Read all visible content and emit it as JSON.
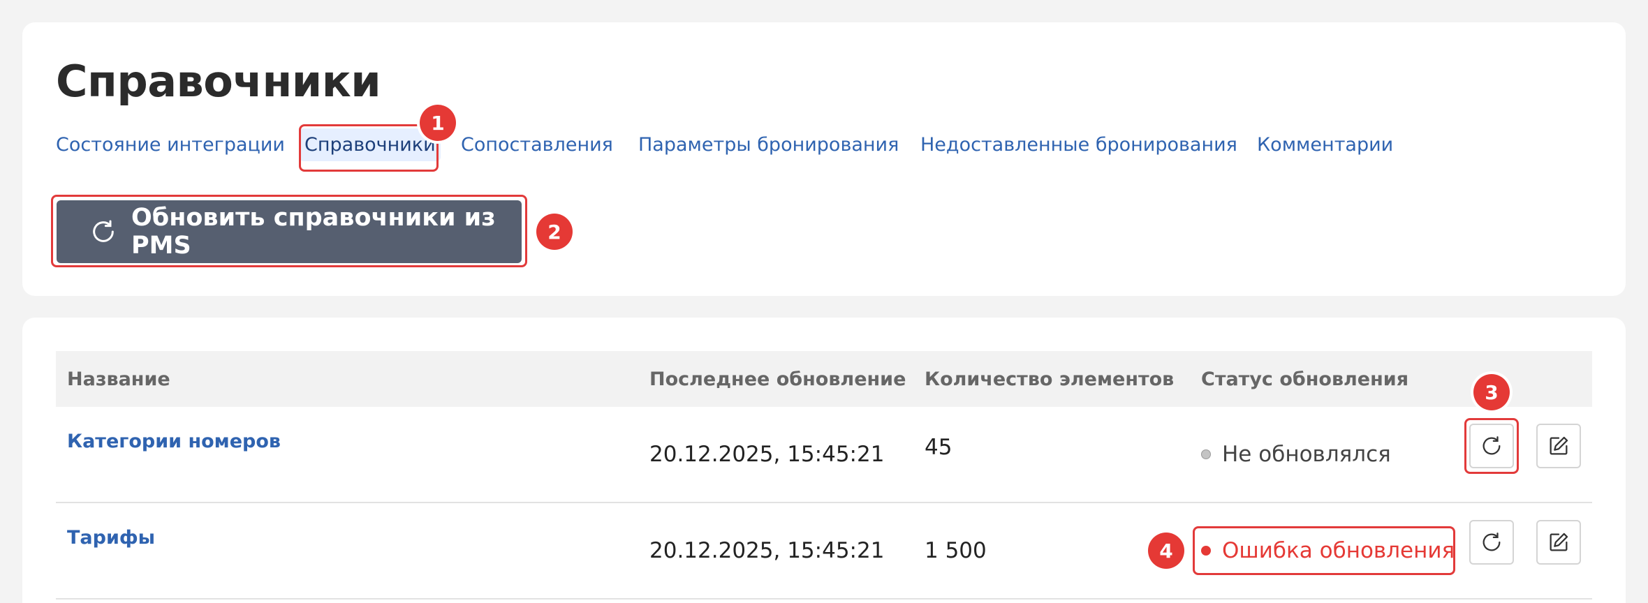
{
  "page": {
    "title": "Справочники"
  },
  "tabs": [
    {
      "label": "Состояние интеграции"
    },
    {
      "label": "Справочники",
      "active": true
    },
    {
      "label": "Сопоставления"
    },
    {
      "label": "Параметры бронирования"
    },
    {
      "label": "Недоставленные бронирования"
    },
    {
      "label": "Комментарии"
    }
  ],
  "toolbar": {
    "refresh_all_label": "Обновить справочники из PMS"
  },
  "table": {
    "columns": [
      "Название",
      "Последнее обновление",
      "Количество элементов",
      "Статус обновления"
    ],
    "rows": [
      {
        "name": "Категории номеров",
        "updated": "20.12.2025, 15:45:21",
        "count": "45",
        "status": "Не обновлялся",
        "status_color": "#b5b5b5"
      },
      {
        "name": "Тарифы",
        "updated": "20.12.2025, 15:45:21",
        "count": "1 500",
        "status": "Ошибка обновления",
        "status_color": "#e53935"
      }
    ]
  },
  "annotations": [
    "1",
    "2",
    "3",
    "4"
  ],
  "colors": {
    "accent": "#2f63b0",
    "button": "#565f70",
    "error": "#e53935",
    "annotation": "#e53935"
  },
  "icons": {
    "refresh": "refresh-icon",
    "edit": "edit-icon"
  }
}
